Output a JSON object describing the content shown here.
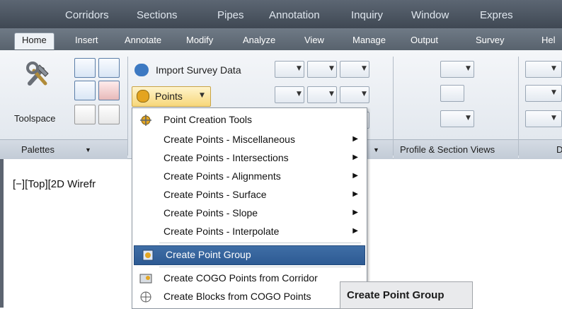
{
  "menubar": {
    "items": [
      "Corridors",
      "Sections",
      "Pipes",
      "Annotation",
      "Inquiry",
      "Window",
      "Expres"
    ]
  },
  "ribbon_tabs": [
    "Home",
    "Insert",
    "Annotate",
    "Modify",
    "Analyze",
    "View",
    "Manage",
    "Output",
    "Survey",
    "Hel"
  ],
  "active_tab": "Home",
  "ribbon": {
    "toolspace_label": "Toolspace",
    "import_survey_label": "Import Survey Data",
    "points_label": "Points",
    "panels": {
      "palettes": "Palettes",
      "profile_section": "Profile & Section Views",
      "partial_right": "D"
    }
  },
  "viewport": {
    "label": "[−][Top][2D Wirefr"
  },
  "dropdown": {
    "items": [
      {
        "label": "Point Creation Tools",
        "submenu": false,
        "icon": "point-tools-icon"
      },
      {
        "label": "Create Points - Miscellaneous",
        "submenu": true
      },
      {
        "label": "Create Points - Intersections",
        "submenu": true
      },
      {
        "label": "Create Points - Alignments",
        "submenu": true
      },
      {
        "label": "Create Points - Surface",
        "submenu": true
      },
      {
        "label": "Create Points - Slope",
        "submenu": true
      },
      {
        "label": "Create Points - Interpolate",
        "submenu": true
      },
      {
        "label": "Create Point Group",
        "submenu": false,
        "highlighted": true,
        "icon": "point-group-icon"
      },
      {
        "label": "Create COGO Points from Corridor",
        "submenu": false,
        "icon": "corridor-points-icon"
      },
      {
        "label": "Create Blocks from COGO Points",
        "submenu": false,
        "icon": "blocks-icon"
      }
    ]
  },
  "tooltip": {
    "text": "Create Point Group"
  },
  "colors": {
    "menubar": "#4b5560",
    "highlight": "#2d5a93",
    "ribbon": "#e6ebf1"
  }
}
